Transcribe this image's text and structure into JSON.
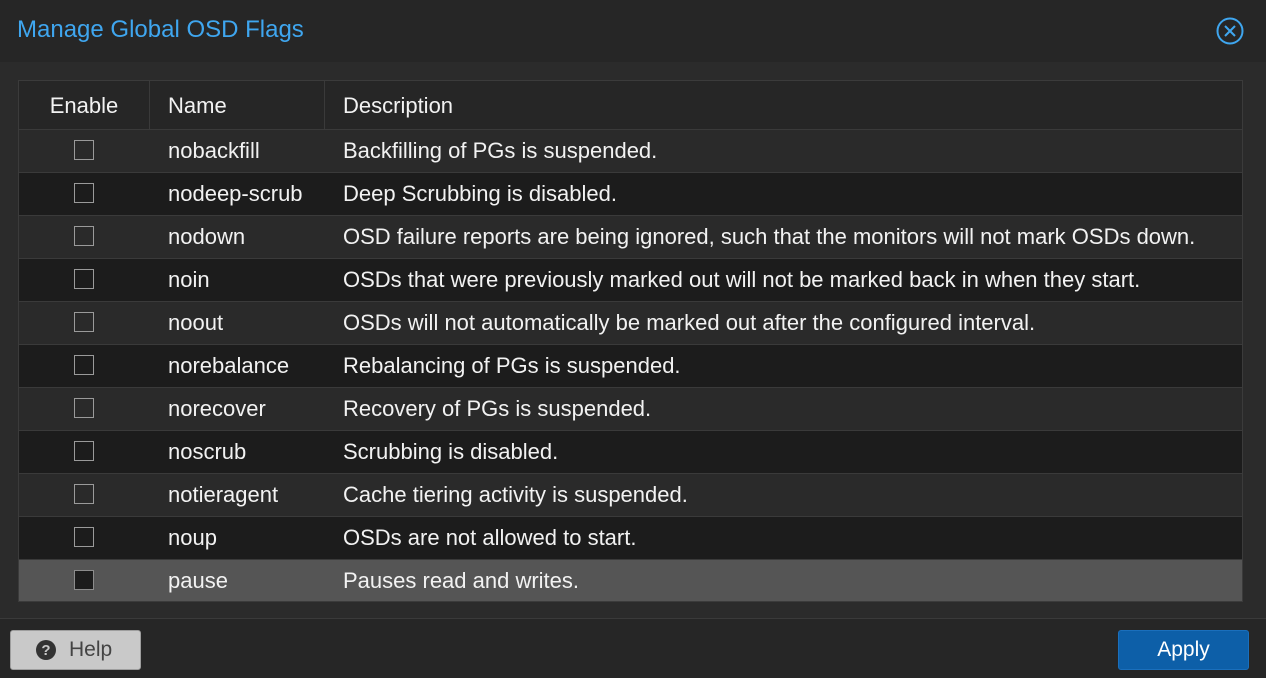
{
  "dialog": {
    "title": "Manage Global OSD Flags",
    "close_icon": "close-circle-icon",
    "accent_color": "#3fa6ef"
  },
  "grid": {
    "columns": [
      "Enable",
      "Name",
      "Description"
    ],
    "rows": [
      {
        "name": "nobackfill",
        "description": "Backfilling of PGs is suspended.",
        "enabled": false
      },
      {
        "name": "nodeep-scrub",
        "description": "Deep Scrubbing is disabled.",
        "enabled": false
      },
      {
        "name": "nodown",
        "description": "OSD failure reports are being ignored, such that the monitors will not mark OSDs down.",
        "enabled": false
      },
      {
        "name": "noin",
        "description": "OSDs that were previously marked out will not be marked back in when they start.",
        "enabled": false
      },
      {
        "name": "noout",
        "description": "OSDs will not automatically be marked out after the configured interval.",
        "enabled": false
      },
      {
        "name": "norebalance",
        "description": "Rebalancing of PGs is suspended.",
        "enabled": false
      },
      {
        "name": "norecover",
        "description": "Recovery of PGs is suspended.",
        "enabled": false
      },
      {
        "name": "noscrub",
        "description": "Scrubbing is disabled.",
        "enabled": false
      },
      {
        "name": "notieragent",
        "description": "Cache tiering activity is suspended.",
        "enabled": false
      },
      {
        "name": "noup",
        "description": "OSDs are not allowed to start.",
        "enabled": false
      },
      {
        "name": "pause",
        "description": "Pauses read and writes.",
        "enabled": false,
        "selected": true
      }
    ]
  },
  "footer": {
    "help_label": "Help",
    "help_icon": "question-circle-icon",
    "apply_label": "Apply",
    "apply_color": "#0d5fa8"
  }
}
